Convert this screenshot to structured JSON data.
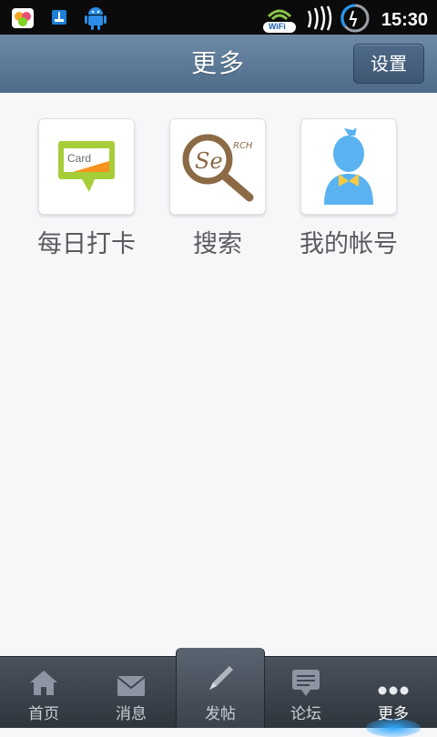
{
  "status_bar": {
    "time": "15:30",
    "wifi_label": "WiFi"
  },
  "header": {
    "title": "更多",
    "settings_label": "设置"
  },
  "tiles": [
    {
      "label": "每日打卡",
      "icon": "card-icon",
      "icon_text": "Card"
    },
    {
      "label": "搜索",
      "icon": "search-magnifier-icon",
      "icon_text": "Se",
      "icon_text2": "RCH"
    },
    {
      "label": "我的帐号",
      "icon": "account-avatar-icon"
    }
  ],
  "tabs": [
    {
      "label": "首页",
      "icon": "home-icon"
    },
    {
      "label": "消息",
      "icon": "mail-icon"
    },
    {
      "label": "发帖",
      "icon": "pencil-icon",
      "active": true
    },
    {
      "label": "论坛",
      "icon": "chat-bubble-icon"
    },
    {
      "label": "更多",
      "icon": "more-dots-icon"
    }
  ]
}
